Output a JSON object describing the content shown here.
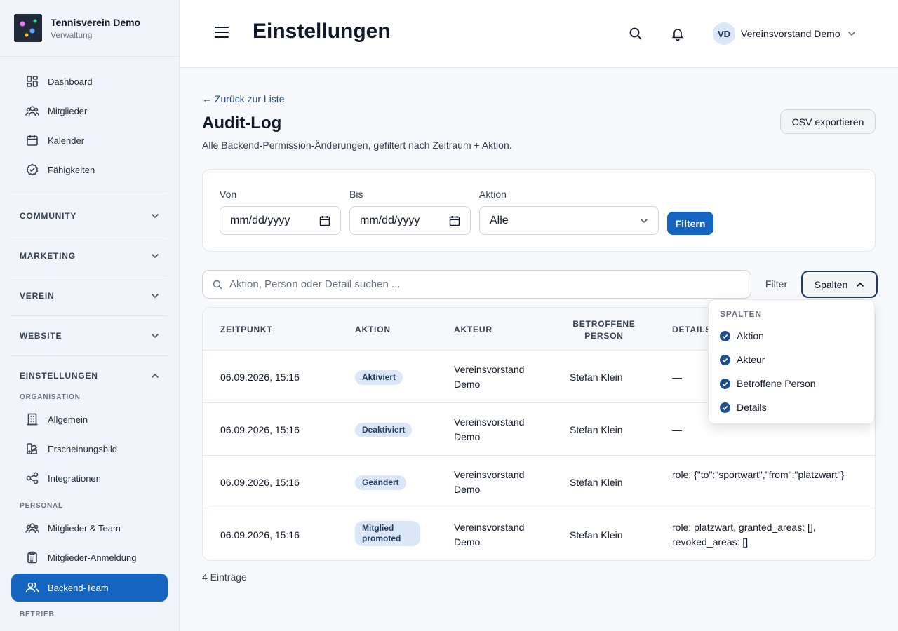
{
  "brand": {
    "title": "Tennisverein Demo",
    "subtitle": "Verwaltung"
  },
  "sidebar": {
    "main_items": [
      {
        "label": "Dashboard",
        "icon": "dashboard-icon"
      },
      {
        "label": "Mitglieder",
        "icon": "members-icon"
      },
      {
        "label": "Kalender",
        "icon": "calendar-icon"
      },
      {
        "label": "Fähigkeiten",
        "icon": "badge-check-icon"
      }
    ],
    "sections": [
      "COMMUNITY",
      "MARKETING",
      "VEREIN",
      "WEBSITE",
      "EINSTELLUNGEN"
    ],
    "subheads": [
      "ORGANISATION",
      "PERSONAL",
      "BETRIEB"
    ],
    "settings_items": [
      {
        "label": "Allgemein",
        "icon": "building-icon"
      },
      {
        "label": "Erscheinungsbild",
        "icon": "palette-icon"
      },
      {
        "label": "Integrationen",
        "icon": "share-icon"
      },
      {
        "label": "Mitglieder & Team",
        "icon": "team-icon"
      },
      {
        "label": "Mitglieder-Anmeldung",
        "icon": "clipboard-icon"
      },
      {
        "label": "Backend-Team",
        "icon": "users-icon"
      }
    ],
    "active_item": "Backend-Team",
    "accent": "#1565c0"
  },
  "header": {
    "title": "Einstellungen",
    "user_initials": "VD",
    "user_name": "Vereinsvorstand Demo"
  },
  "page": {
    "back_label": "← Zurück zur Liste",
    "title": "Audit-Log",
    "subtitle": "Alle Backend-Permission-Änderungen, gefiltert nach Zeitraum + Aktion.",
    "csv_label": "CSV exportieren"
  },
  "filters": {
    "from_label": "Von",
    "from_value": "mm/dd/yyyy",
    "to_label": "Bis",
    "to_value": "mm/dd/yyyy",
    "action_label": "Aktion",
    "action_value": "Alle",
    "submit_label": "Filtern"
  },
  "toolbar": {
    "search_placeholder": "Aktion, Person oder Detail suchen ...",
    "filter_label": "Filter",
    "columns_label": "Spalten"
  },
  "table": {
    "headers": [
      "ZEITPUNKT",
      "AKTION",
      "AKTEUR",
      "BETROFFENE PERSON",
      "DETAILS"
    ],
    "rows": [
      {
        "time": "06.09.2026, 15:16",
        "action": "Aktiviert",
        "actor": "Vereinsvorstand Demo",
        "person": "Stefan Klein",
        "details": "—"
      },
      {
        "time": "06.09.2026, 15:16",
        "action": "Deaktiviert",
        "actor": "Vereinsvorstand Demo",
        "person": "Stefan Klein",
        "details": "—"
      },
      {
        "time": "06.09.2026, 15:16",
        "action": "Geändert",
        "actor": "Vereinsvorstand Demo",
        "person": "Stefan Klein",
        "details": "role: {\"to\":\"sportwart\",\"from\":\"platzwart\"}"
      },
      {
        "time": "06.09.2026, 15:16",
        "action": "Mitglied promoted",
        "actor": "Vereinsvorstand Demo",
        "person": "Stefan Klein",
        "details": "role: platzwart, granted_areas: [], revoked_areas: []"
      }
    ],
    "count_label": "4 Einträge"
  },
  "columns_menu": {
    "title": "SPALTEN",
    "items": [
      "Aktion",
      "Akteur",
      "Betroffene Person",
      "Details"
    ]
  }
}
